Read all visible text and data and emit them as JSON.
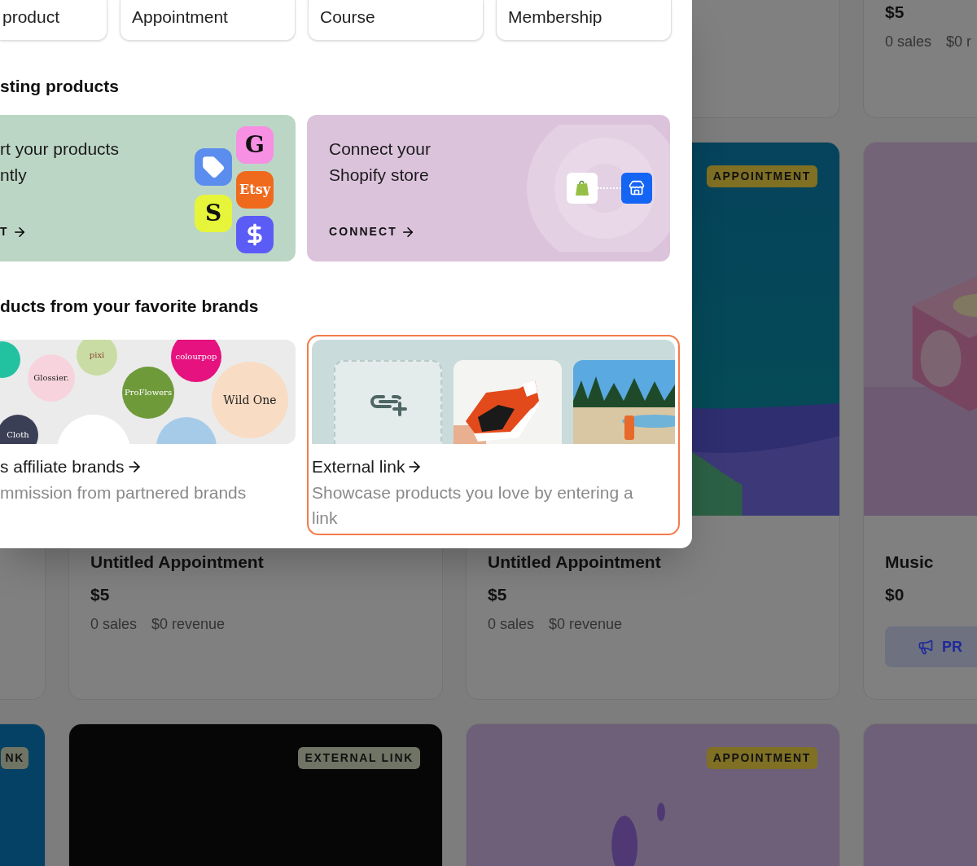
{
  "product_grid": {
    "rows": [
      {
        "kind": "cut_top",
        "cards": [
          {
            "kind": "blank"
          },
          {
            "kind": "blank"
          },
          {
            "kind": "blank"
          },
          {
            "kind": "product",
            "price": "$5",
            "sales": "0 sales",
            "revenue": "$0 r"
          }
        ]
      },
      {
        "kind": "full",
        "cards": [
          {
            "kind": "blank"
          },
          {
            "kind": "product",
            "title": "Untitled Appointment",
            "price": "$5",
            "sales": "0 sales",
            "revenue": "$0 revenue"
          },
          {
            "kind": "product",
            "image": {
              "kind": "picture"
            },
            "badge": {
              "text": "APPOINTMENT",
              "color": "#7f7024"
            },
            "title": "Untitled Appointment",
            "price": "$5",
            "sales": "0 sales",
            "revenue": "$0 revenue"
          },
          {
            "kind": "product",
            "image": {
              "kind": "picture"
            },
            "title": "Music",
            "price": "$0",
            "button": "PR"
          }
        ]
      },
      {
        "kind": "full",
        "cards": [
          {
            "kind": "product",
            "image": {
              "kind": "picture"
            },
            "badge": {
              "text": "NK",
              "color": "#6f7464"
            }
          },
          {
            "kind": "product",
            "image": {
              "kind": "picture"
            },
            "badge": {
              "text": "EXTERNAL LINK",
              "color": "#6f7464"
            }
          },
          {
            "kind": "product",
            "image": {
              "kind": "picture"
            },
            "badge": {
              "text": "APPOINTMENT",
              "color": "#7f7024"
            }
          },
          {
            "kind": "product",
            "image": {
              "kind": "picture"
            }
          }
        ]
      }
    ]
  },
  "modal": {
    "type_options": [
      "product",
      "Appointment",
      "Course",
      "Membership"
    ],
    "import_section": {
      "heading": "sting products",
      "import_card": {
        "lines": [
          "rt your products",
          "ntly"
        ],
        "cta": "T",
        "app_icons": [
          {
            "kind": "tag",
            "color": "#5b8def"
          },
          {
            "kind": "letter",
            "text": "S",
            "color": "#e6f53a"
          },
          {
            "kind": "letter",
            "text": "G",
            "color": "#f78fe3"
          },
          {
            "kind": "letter",
            "text": "Etsy",
            "color": "#f06a1d"
          },
          {
            "kind": "dollar",
            "color": "#5b5cf6"
          }
        ]
      },
      "shopify_card": {
        "lines": [
          "Connect your",
          "Shopify store"
        ],
        "cta": "CONNECT"
      }
    },
    "brands_section": {
      "heading": "ducts from your favorite brands",
      "cards": [
        {
          "kind": "brands",
          "selected": false,
          "title": "s affiliate brands",
          "description": "mmission from partnered brands",
          "bubbles": [
            {
              "color": "#22c1a0"
            },
            {
              "text": "pixi",
              "color": "#c9dca3"
            },
            {
              "text": "Glossier.",
              "color": "#f7d4dd"
            },
            {
              "text": "colourpop",
              "color": "#e5127f"
            },
            {
              "text": "ProFlowers",
              "color": "#6f9a3a"
            },
            {
              "text": "Wild One",
              "color": "#f9dcc4"
            },
            {
              "text": "Cloth",
              "color": "#3b3f55"
            },
            {
              "color": "#ffffff"
            },
            {
              "color": "#a6cbe9"
            }
          ]
        },
        {
          "kind": "tiles",
          "selected": true,
          "title": "External link",
          "description": "Showcase products you love by entering a link",
          "tiles": [
            {
              "kind": "link"
            },
            {
              "kind": "picture"
            },
            {
              "kind": "picture"
            }
          ]
        }
      ]
    }
  }
}
